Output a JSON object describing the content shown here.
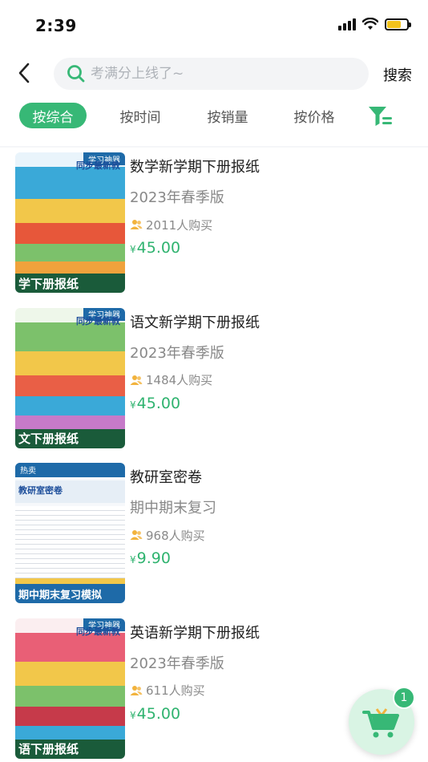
{
  "status_bar": {
    "time": "2:39"
  },
  "header": {
    "search_placeholder": "考满分上线了~",
    "search_button": "搜索"
  },
  "tabs": [
    {
      "label": "按综合",
      "active": true
    },
    {
      "label": "按时间",
      "active": false
    },
    {
      "label": "按销量",
      "active": false
    },
    {
      "label": "按价格",
      "active": false
    }
  ],
  "accent_color": "#37b876",
  "products": [
    {
      "title": "数学新学期下册报纸",
      "subtitle": "2023年春季版",
      "buyers": "2011人购买",
      "currency": "¥",
      "price": "45.00",
      "thumb": {
        "tag": "学习神器",
        "header": "同步最新教",
        "caption": "学下册报纸",
        "colors": [
          "#3aa9d8",
          "#f2c74a",
          "#e7573a",
          "#7cc16b",
          "#f0a23c"
        ]
      }
    },
    {
      "title": "语文新学期下册报纸",
      "subtitle": "2023年春季版",
      "buyers": "1484人购买",
      "currency": "¥",
      "price": "45.00",
      "thumb": {
        "tag": "学习神器",
        "header": "同步最新教",
        "caption": "文下册报纸",
        "colors": [
          "#7cc16b",
          "#f2c74a",
          "#e95f46",
          "#3aa9d8",
          "#c67ac9"
        ]
      }
    },
    {
      "title": "教研室密卷",
      "subtitle": "期中期末复习",
      "buyers": "968人购买",
      "currency": "¥",
      "price": "9.90",
      "thumb": {
        "tag": "热卖",
        "header": "教研室密卷",
        "caption": "期中期末复习模拟",
        "colors": [
          "#1e6aa8",
          "#e6eef6",
          "#f4f4f4",
          "#ffffff",
          "#f2c74a"
        ]
      }
    },
    {
      "title": "英语新学期下册报纸",
      "subtitle": "2023年春季版",
      "buyers": "611人购买",
      "currency": "¥",
      "price": "45.00",
      "thumb": {
        "tag": "学习神器",
        "header": "同步最新教",
        "caption": "语下册报纸",
        "colors": [
          "#e95f76",
          "#f2c74a",
          "#7cc16b",
          "#c63a4a",
          "#3aa9d8"
        ]
      }
    }
  ],
  "cart": {
    "count": "1"
  }
}
